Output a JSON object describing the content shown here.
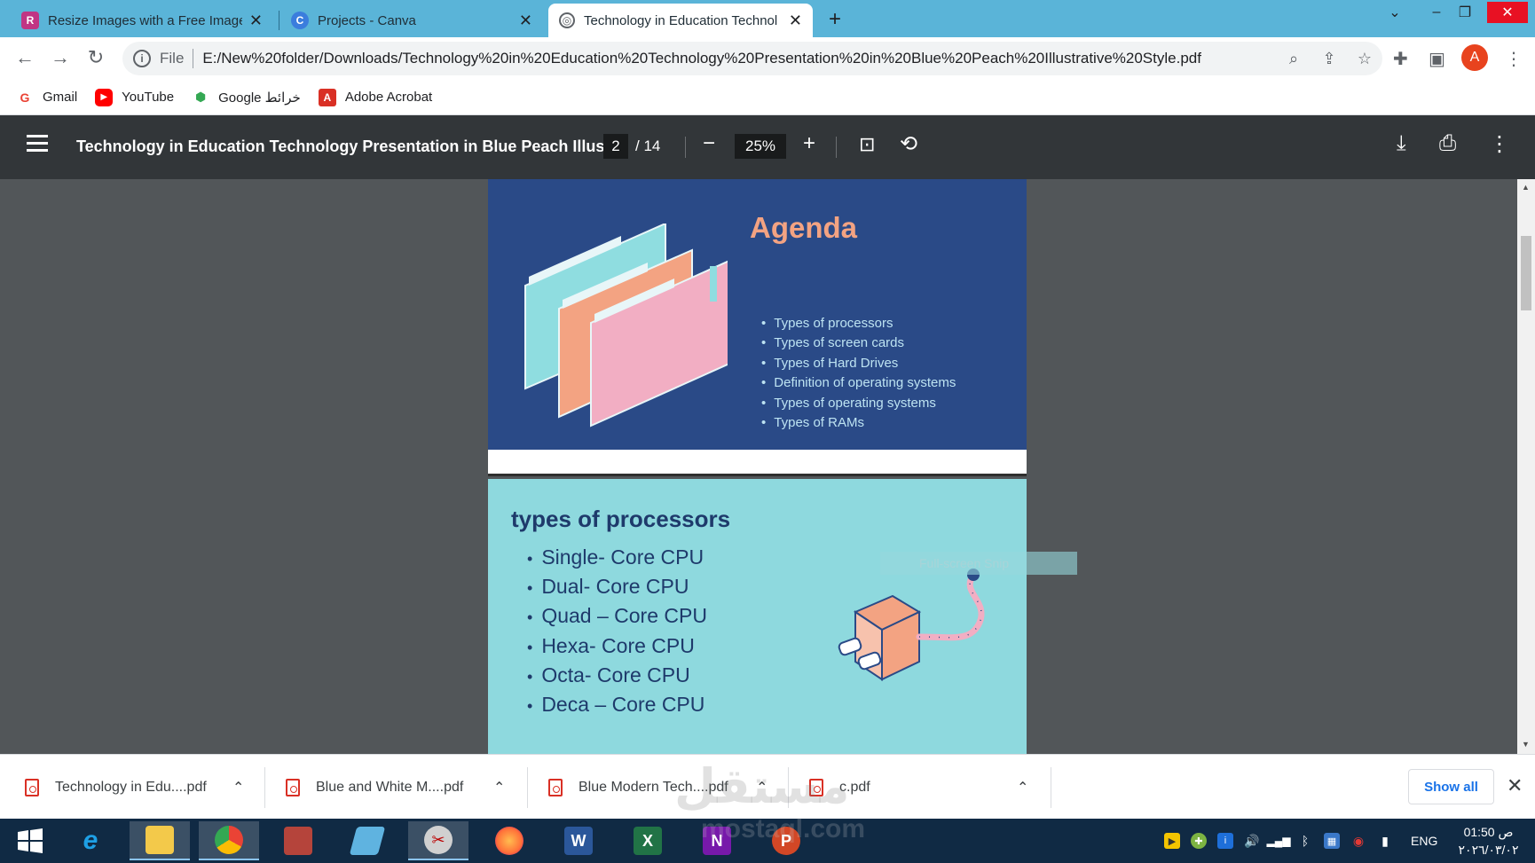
{
  "browser": {
    "tabs": [
      {
        "title": "Resize Images with a Free Image",
        "icon": "resize-app-icon",
        "active": false
      },
      {
        "title": "Projects - Canva",
        "icon": "canva-icon",
        "active": false
      },
      {
        "title": "Technology in Education Technol",
        "icon": "globe-icon",
        "active": true
      }
    ],
    "new_tab": "+",
    "avatar_letter": "A",
    "address": {
      "scheme_label": "File",
      "url": "E:/New%20folder/Downloads/Technology%20in%20Education%20Technology%20Presentation%20in%20Blue%20Peach%20Illustrative%20Style.pdf"
    },
    "bookmarks": [
      {
        "label": "Gmail",
        "icon": "gmail-icon",
        "glyph": "G",
        "color": "#ea4335"
      },
      {
        "label": "YouTube",
        "icon": "youtube-icon",
        "glyph": "▶",
        "color": "#ff0000"
      },
      {
        "label": "Google خرائط",
        "icon": "maps-icon",
        "glyph": "⬢",
        "color": "#34a853"
      },
      {
        "label": "Adobe Acrobat",
        "icon": "acrobat-icon",
        "glyph": "A",
        "color": "#d93025"
      }
    ]
  },
  "pdf_viewer": {
    "title": "Technology in Education Technology Presentation in Blue Peach Illustr...",
    "current_page": "2",
    "total_pages": "/ 14",
    "zoom": "25%",
    "zoom_out": "−",
    "zoom_in": "+"
  },
  "slides": {
    "agenda": {
      "title": "Agenda",
      "items": [
        "Types of processors",
        "Types of screen cards",
        "Types of Hard Drives",
        "Definition of operating systems",
        "Types of operating systems",
        "Types of RAMs"
      ]
    },
    "processors": {
      "title": "types of processors",
      "items": [
        "Single- Core CPU",
        "Dual- Core CPU",
        "Quad – Core CPU",
        "Hexa- Core CPU",
        "Octa- Core CPU",
        "Deca – Core CPU"
      ]
    },
    "snip_label": "Full-screen Snip"
  },
  "downloads": {
    "items": [
      "Technology in Edu....pdf",
      "Blue and White M....pdf",
      "Blue Modern Tech....pdf",
      "c.pdf"
    ],
    "show_all": "Show all"
  },
  "taskbar": {
    "apps": [
      {
        "icon": "start-icon",
        "color": "#ffffff"
      },
      {
        "icon": "internet-explorer-icon",
        "color": "#1ea0e6"
      },
      {
        "icon": "file-explorer-icon",
        "color": "#f3c94a"
      },
      {
        "icon": "chrome-icon",
        "color": "#34a853"
      },
      {
        "icon": "winrar-icon",
        "color": "#b5443b"
      },
      {
        "icon": "notepad-icon",
        "color": "#5fb3e0"
      },
      {
        "icon": "snipping-tool-icon",
        "color": "#d0d0d0"
      },
      {
        "icon": "firefox-icon",
        "color": "#ff7139"
      },
      {
        "icon": "word-icon",
        "color": "#2b579a"
      },
      {
        "icon": "excel-icon",
        "color": "#217346"
      },
      {
        "icon": "onenote-icon",
        "color": "#7719aa"
      },
      {
        "icon": "powerpoint-icon",
        "color": "#d24726"
      }
    ],
    "language": "ENG",
    "time": "01:50 ص",
    "date": "٢٠٢٦/٠٣/٠٢"
  },
  "watermark": {
    "text": "مستقل",
    "domain": "mostaql.com"
  }
}
